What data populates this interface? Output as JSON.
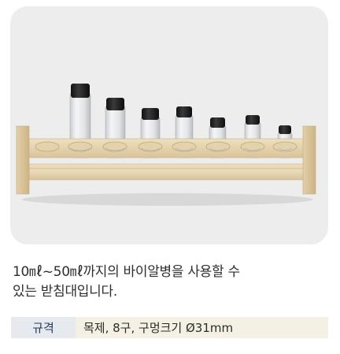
{
  "product": {
    "image_alt": "wooden-vial-rack-photo",
    "description_line1": "10㎖~50㎖까지의  바이알병을  사용할  수",
    "description_line2": "있는 받침대입니다."
  },
  "spec": {
    "label": "규격",
    "value": "목제, 8구, 구멍크기 Ø31mm"
  }
}
